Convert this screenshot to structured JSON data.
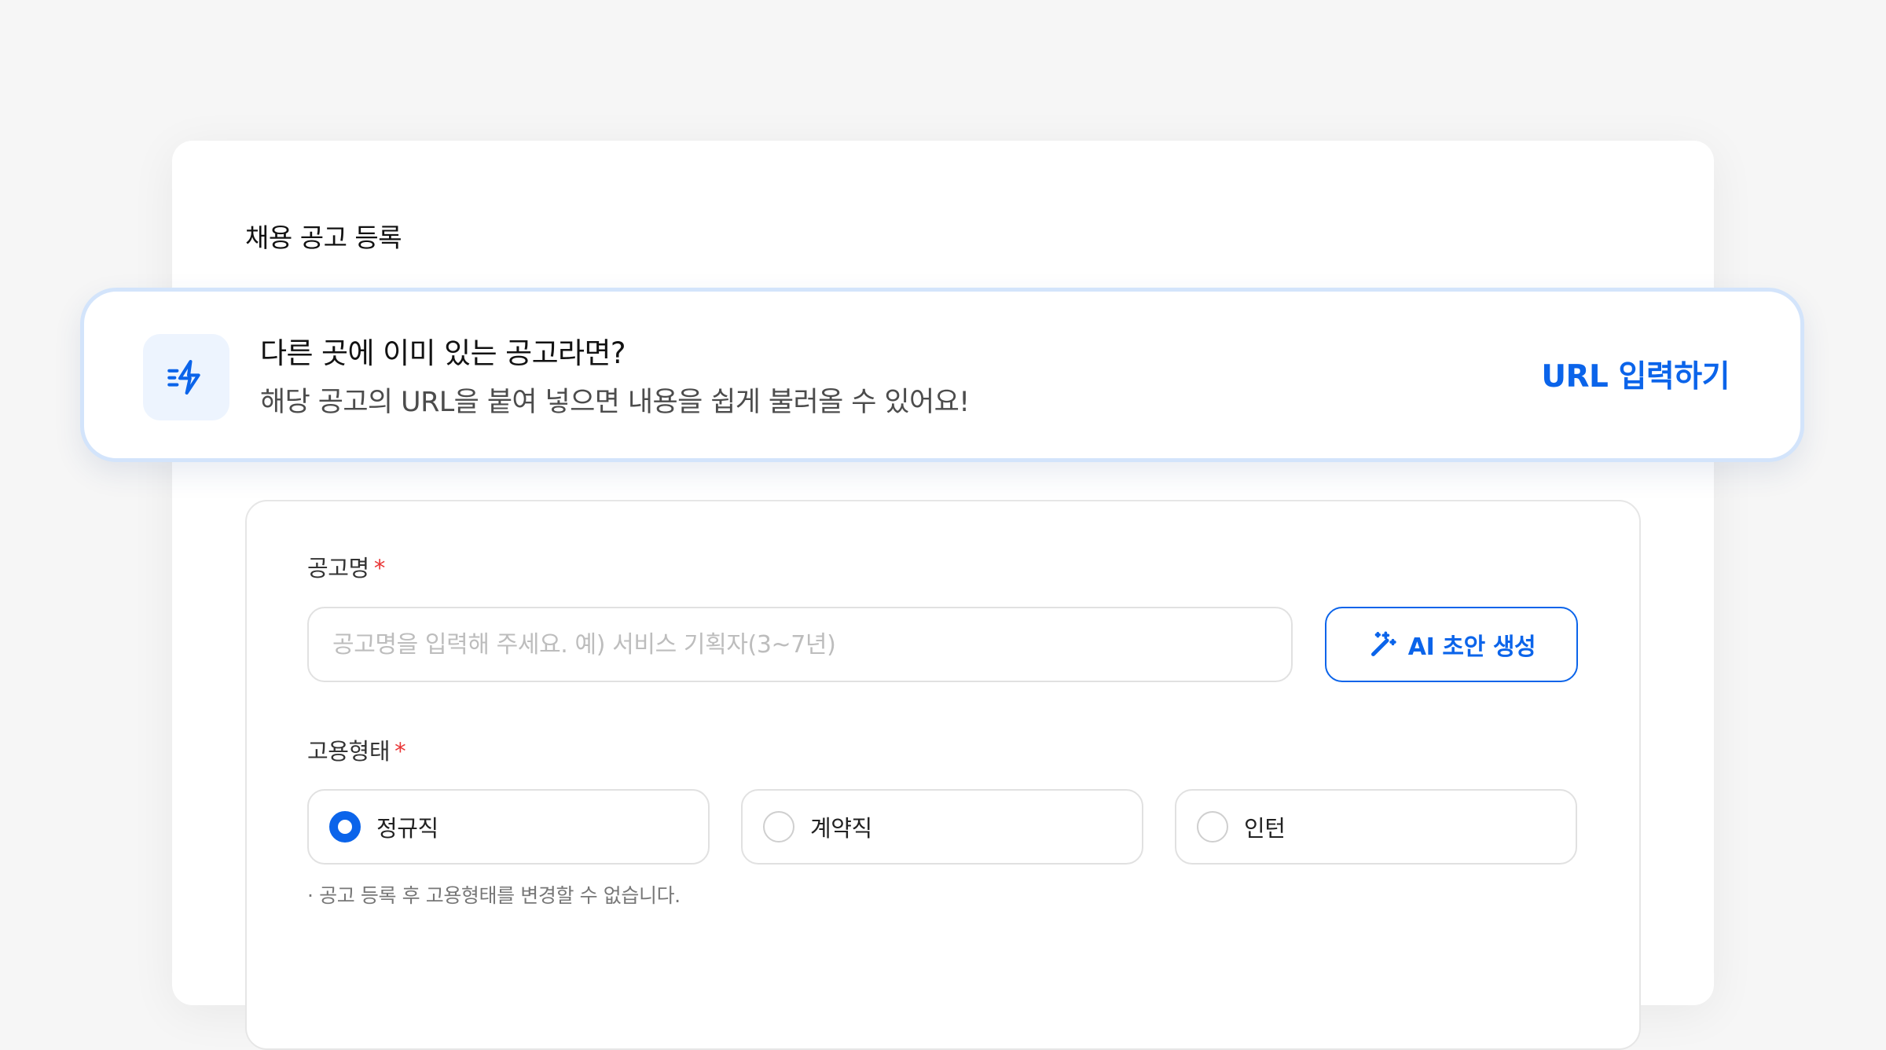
{
  "page": {
    "title": "채용 공고 등록"
  },
  "banner": {
    "icon": "lightning-bolt-icon",
    "title": "다른 곳에 이미 있는 공고라면?",
    "subtitle": "해당 공고의 URL을 붙여 넣으면 내용을 쉽게 불러올 수 있어요!",
    "link_label": "URL 입력하기"
  },
  "form": {
    "job_title": {
      "label": "공고명",
      "required_mark": "*",
      "value": "",
      "placeholder": "공고명을 입력해 주세요. 예) 서비스 기획자(3~7년)"
    },
    "ai_button": {
      "icon": "magic-wand-icon",
      "label": "AI 초안 생성"
    },
    "employment_type": {
      "label": "고용형태",
      "required_mark": "*",
      "options": [
        {
          "label": "정규직",
          "selected": true
        },
        {
          "label": "계약직",
          "selected": false
        },
        {
          "label": "인턴",
          "selected": false
        }
      ],
      "help_text": "· 공고 등록 후 고용형태를 변경할 수 없습니다."
    }
  },
  "colors": {
    "accent": "#0b64ea",
    "required": "#e93636",
    "banner_border": "#d3e4fb",
    "icon_bg": "#edf4fe",
    "page_bg": "#f6f6f6"
  }
}
